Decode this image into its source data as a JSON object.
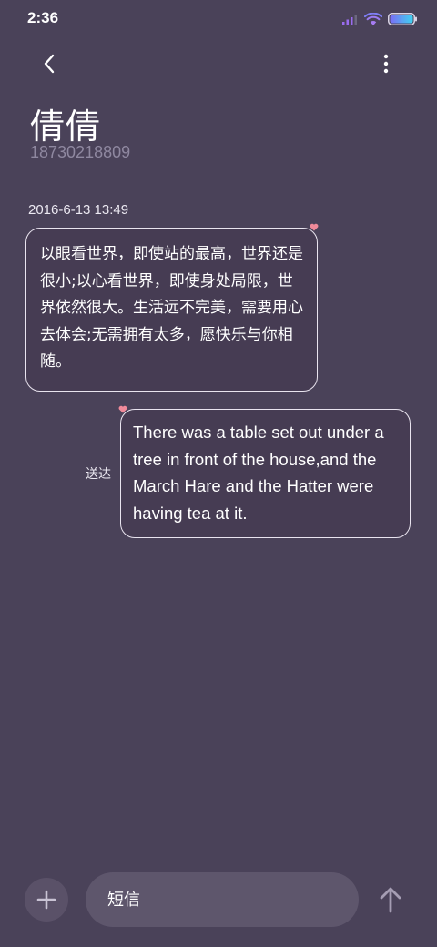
{
  "status_bar": {
    "time": "2:36",
    "icons": [
      "signal-icon",
      "wifi-icon",
      "battery-icon"
    ],
    "battery_gradient": [
      "#7b6cf6",
      "#3fd3f0"
    ]
  },
  "header": {
    "back_icon": "chevron-left-icon",
    "more_icon": "more-vertical-icon"
  },
  "contact": {
    "name": "倩倩",
    "number": "18730218809"
  },
  "conversation": {
    "timestamp": "2016-6-13 13:49",
    "incoming_message": "以眼看世界，即使站的最高，世界还是很小;以心看世界，即使身处局限，世界依然很大。生活远不完美，需要用心去体会;无需拥有太多，愿快乐与你相随。",
    "outgoing_message": "There was a table set out under a tree in front of the house,and the March Hare and the Hatter were having tea at it.",
    "outgoing_status": "送达",
    "heart_color": "#f08a9a"
  },
  "composer": {
    "attach_icon": "plus-icon",
    "placeholder": "短信",
    "send_icon": "arrow-up-icon"
  },
  "colors": {
    "background": "#4a4259",
    "bubble_border": "#e9e4ef",
    "secondary_text": "#8f88a0"
  }
}
